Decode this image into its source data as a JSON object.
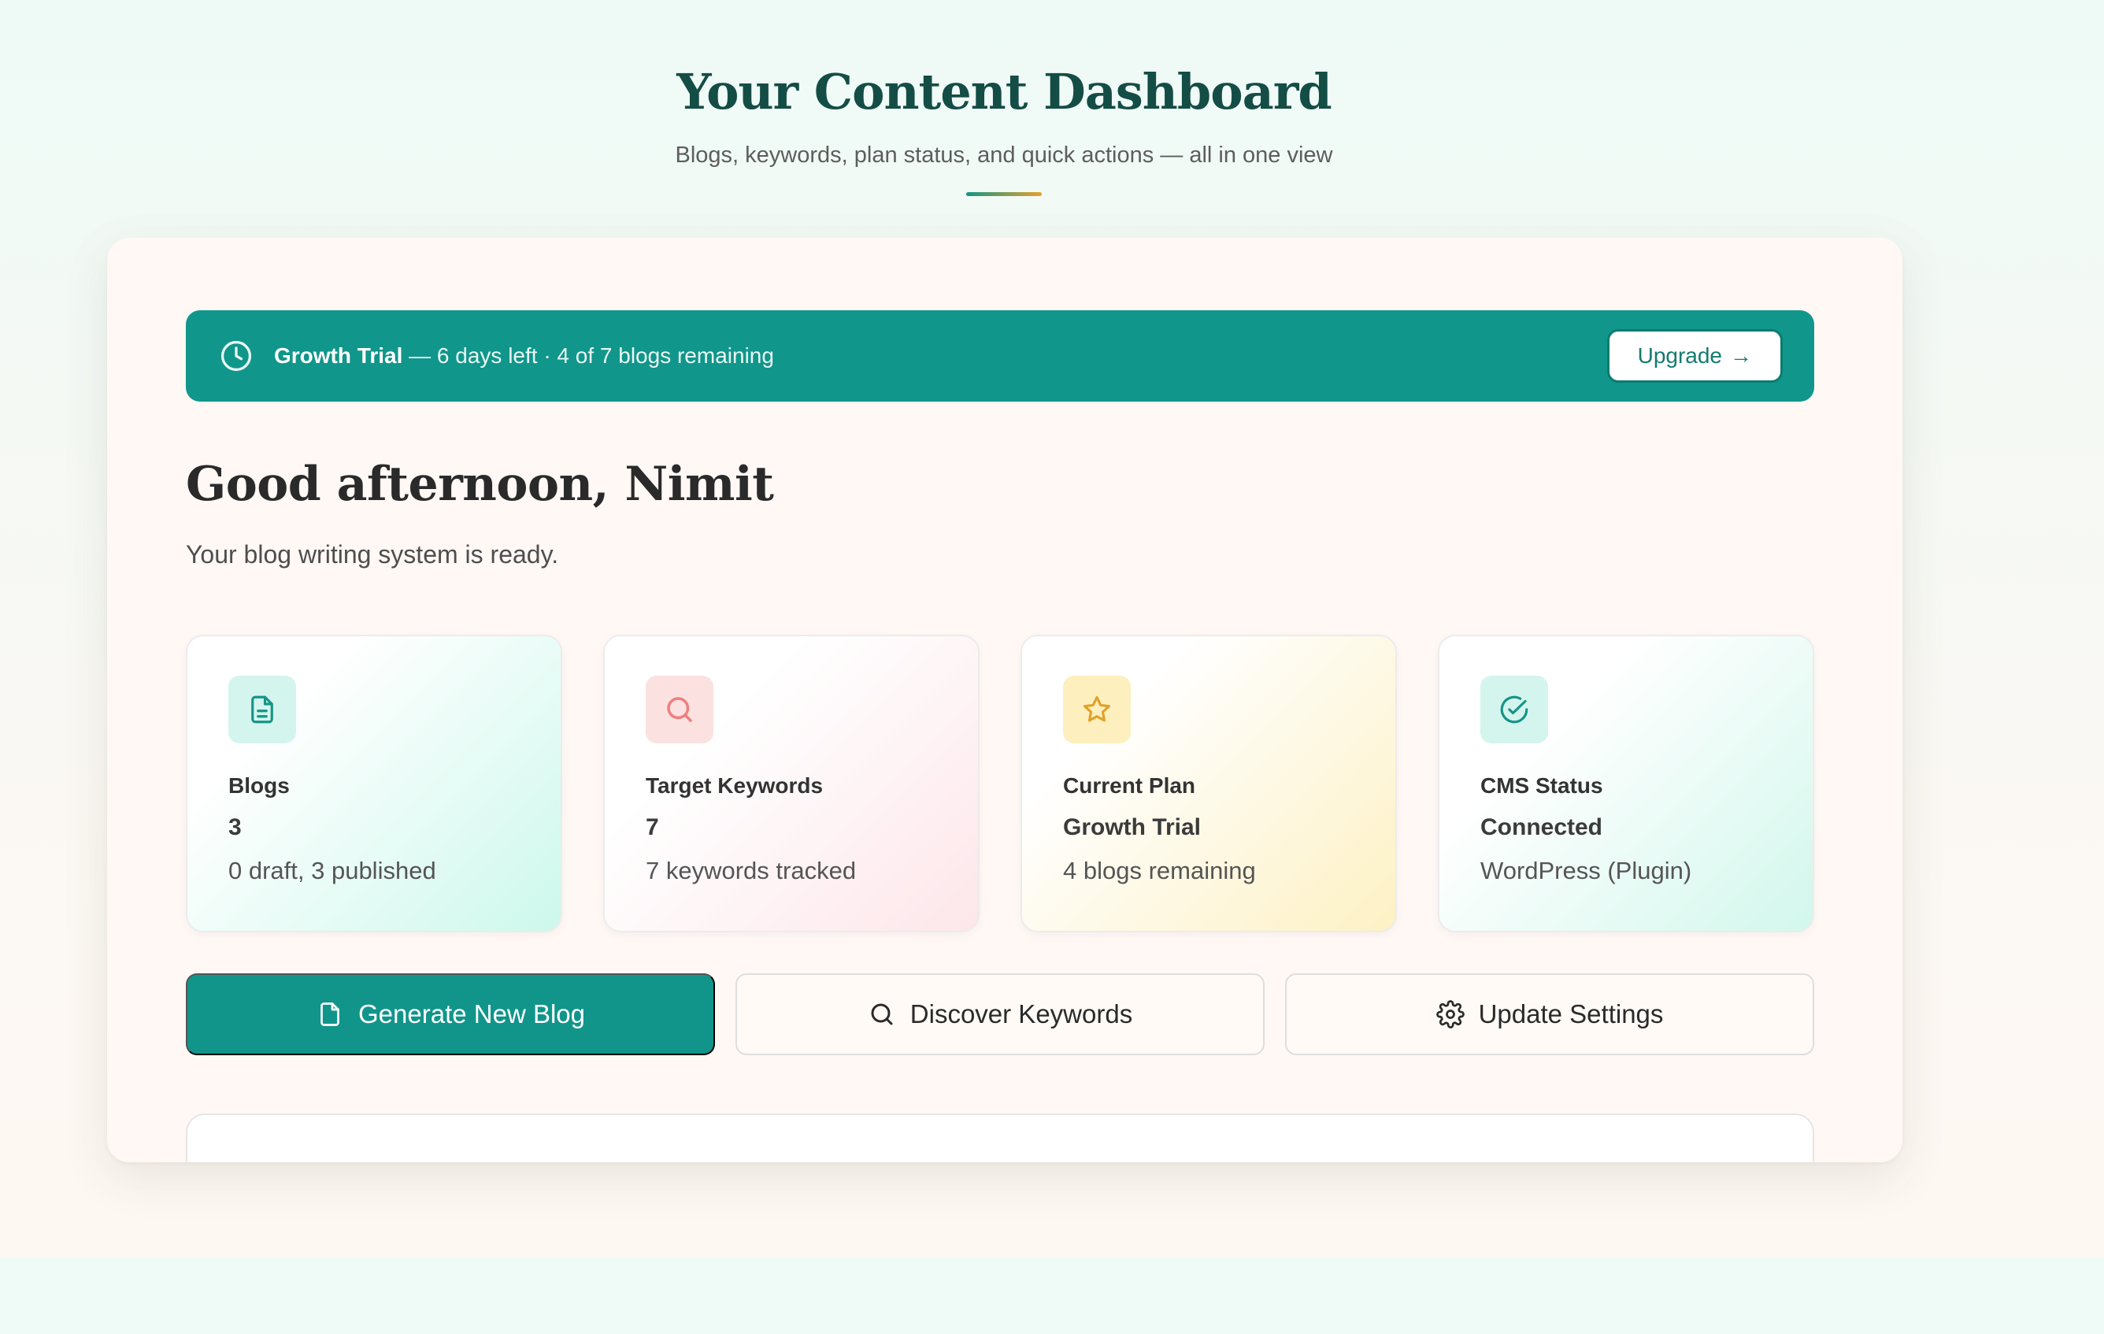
{
  "hero": {
    "title": "Your Content Dashboard",
    "subtitle": "Blogs, keywords, plan status, and quick actions — all in one view"
  },
  "trial_banner": {
    "icon": "clock-icon",
    "plan_name": "Growth Trial",
    "details": " — 6 days left · 4 of 7 blogs remaining",
    "upgrade_label": "Upgrade",
    "upgrade_arrow": "→"
  },
  "greeting": {
    "title": "Good afternoon, Nimit",
    "subtitle": "Your blog writing system is ready."
  },
  "stats": [
    {
      "icon": "document-icon",
      "label": "Blogs",
      "value": "3",
      "detail": "0 draft, 3 published",
      "accent": "#159487"
    },
    {
      "icon": "search-icon",
      "label": "Target Keywords",
      "value": "7",
      "detail": "7 keywords tracked",
      "accent": "#ef7f7f"
    },
    {
      "icon": "star-icon",
      "label": "Current Plan",
      "value": "Growth Trial",
      "detail": "4 blogs remaining",
      "accent": "#e0a12b"
    },
    {
      "icon": "check-circle-icon",
      "label": "CMS Status",
      "value": "Connected",
      "detail": "WordPress (Plugin)",
      "accent": "#159487"
    }
  ],
  "actions": {
    "generate": {
      "label": "Generate New Blog",
      "icon": "document-icon"
    },
    "discover": {
      "label": "Discover Keywords",
      "icon": "search-icon"
    },
    "settings": {
      "label": "Update Settings",
      "icon": "gear-icon"
    }
  },
  "colors": {
    "brand": "#10968a",
    "heading": "#144d45",
    "accent_gold": "#e6a22b"
  }
}
